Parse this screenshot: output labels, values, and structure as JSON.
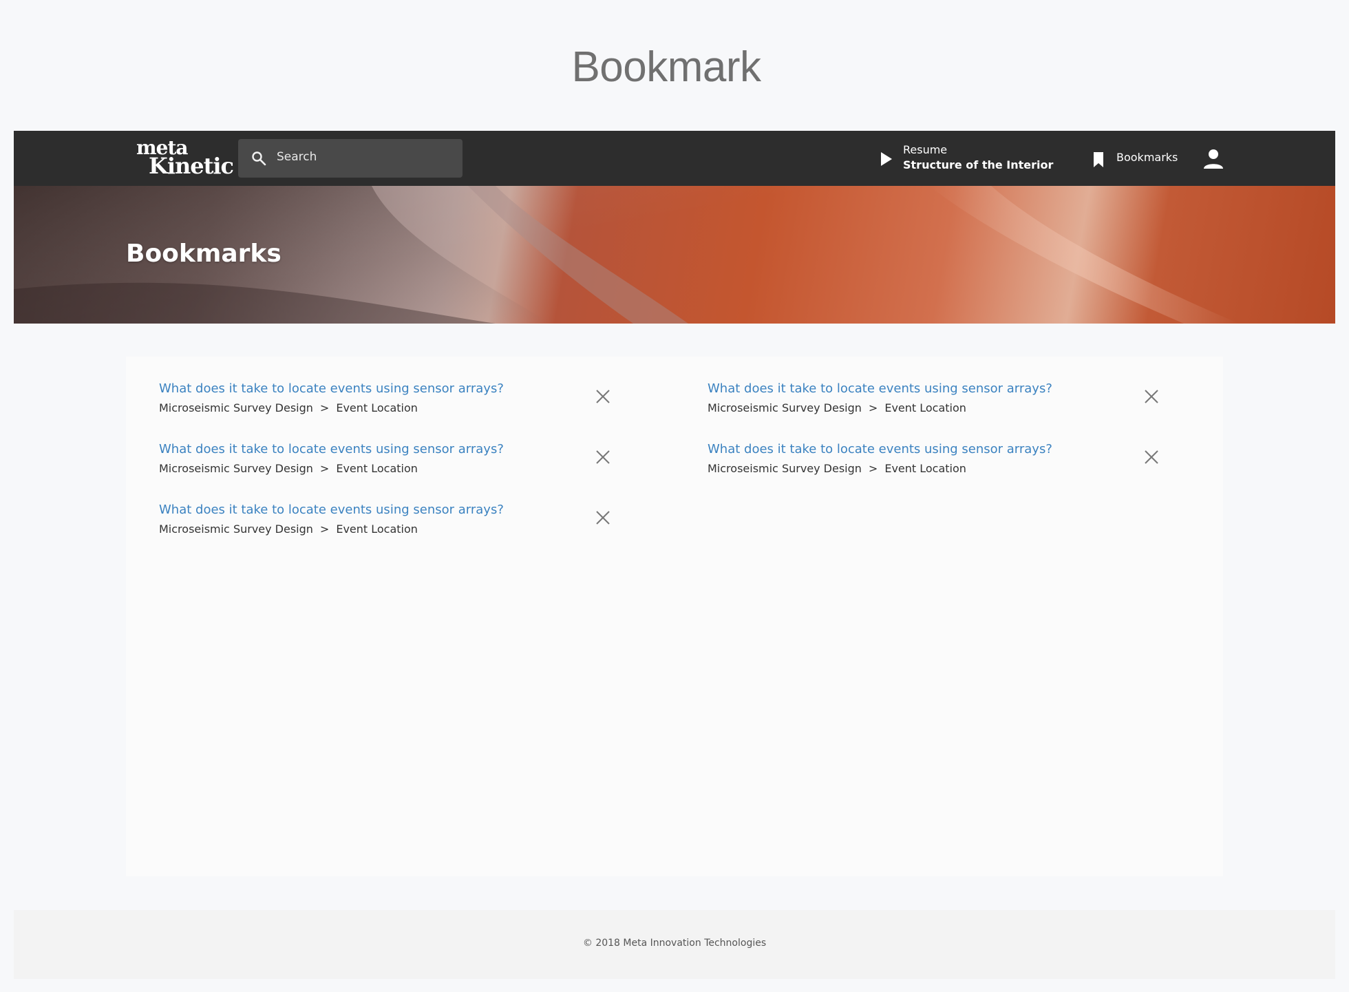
{
  "page_heading": "Bookmark",
  "navbar": {
    "logo_line1": "meta",
    "logo_line2": "Kinetic",
    "search_placeholder": "Search",
    "resume_label": "Resume",
    "resume_title": "Structure of the Interior",
    "bookmarks_label": "Bookmarks"
  },
  "hero": {
    "title": "Bookmarks"
  },
  "bookmarks": [
    {
      "title": "What does it take to locate events using sensor arrays?",
      "course": "Microseismic Survey Design",
      "separator": ">",
      "lesson": "Event Location"
    },
    {
      "title": "What does it take to locate events using sensor arrays?",
      "course": "Microseismic Survey Design",
      "separator": ">",
      "lesson": "Event Location"
    },
    {
      "title": "What does it take to locate events using sensor arrays?",
      "course": "Microseismic Survey Design",
      "separator": ">",
      "lesson": "Event Location"
    },
    {
      "title": "What does it take to locate events using sensor arrays?",
      "course": "Microseismic Survey Design",
      "separator": ">",
      "lesson": "Event Location"
    },
    {
      "title": "What does it take to locate events using sensor arrays?",
      "course": "Microseismic Survey Design",
      "separator": ">",
      "lesson": "Event Location"
    }
  ],
  "footer": {
    "copyright": "© 2018 Meta Innovation Technologies"
  },
  "colors": {
    "navbar": "#2d2d2d",
    "link": "#3b82c0",
    "search_bg": "#494949"
  }
}
